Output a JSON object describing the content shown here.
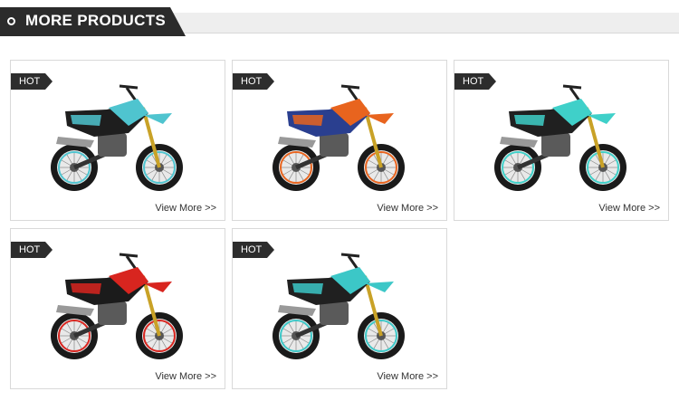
{
  "header": {
    "title": "MORE PRODUCTS"
  },
  "products": [
    {
      "badge": "HOT",
      "link": "View More >>",
      "accent": "#4fc4cf",
      "frame": "#1e1e1e"
    },
    {
      "badge": "HOT",
      "link": "View More >>",
      "accent": "#e8641e",
      "frame": "#2a3f8f"
    },
    {
      "badge": "HOT",
      "link": "View More >>",
      "accent": "#3fd0c9",
      "frame": "#202020"
    },
    {
      "badge": "HOT",
      "link": "View More >>",
      "accent": "#d8251f",
      "frame": "#1b1b1b"
    },
    {
      "badge": "HOT",
      "link": "View More >>",
      "accent": "#3cc7c7",
      "frame": "#202020"
    }
  ]
}
